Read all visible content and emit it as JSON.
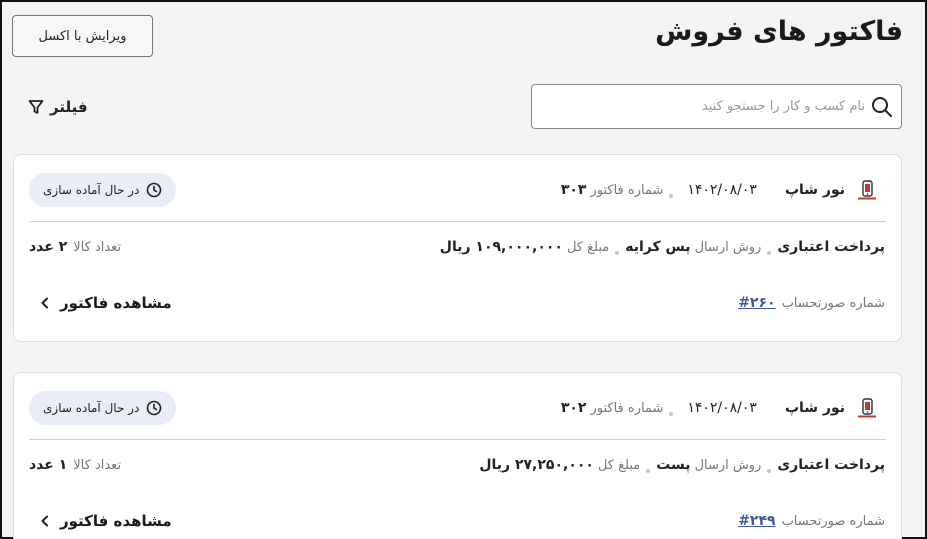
{
  "header": {
    "title": "فاکتور های فروش",
    "excel_button": "ویرایش با اکسل"
  },
  "search": {
    "placeholder": "نام کسب و کار را جستجو کنید",
    "value": ""
  },
  "filter": {
    "label": "فیلتر"
  },
  "invoices": [
    {
      "shop": "نور شاپ",
      "date": "۱۴۰۲/۰۸/۰۳",
      "invoice_no_label": "شماره فاکتور",
      "invoice_no": "۳۰۳",
      "status": "در حال آماده سازی",
      "payment": "پرداخت اعتباری",
      "shipping_label": "روش ارسال",
      "shipping": "پس کرایه",
      "total_label": "مبلغ کل",
      "total": "۱۰۹,۰۰۰,۰۰۰ ریال",
      "qty_label": "تعداد کالا",
      "qty": "۲ عدد",
      "account_label": "شماره صورتحساب",
      "account_no": "#۲۶۰",
      "view_label": "مشاهده فاکتور"
    },
    {
      "shop": "نور شاپ",
      "date": "۱۴۰۲/۰۸/۰۳",
      "invoice_no_label": "شماره فاکتور",
      "invoice_no": "۳۰۲",
      "status": "در حال آماده سازی",
      "payment": "پرداخت اعتباری",
      "shipping_label": "روش ارسال",
      "shipping": "پست",
      "total_label": "مبلغ کل",
      "total": "۲۷,۲۵۰,۰۰۰ ریال",
      "qty_label": "تعداد کالا",
      "qty": "۱ عدد",
      "account_label": "شماره صورتحساب",
      "account_no": "#۲۴۹",
      "view_label": "مشاهده فاکتور"
    }
  ]
}
